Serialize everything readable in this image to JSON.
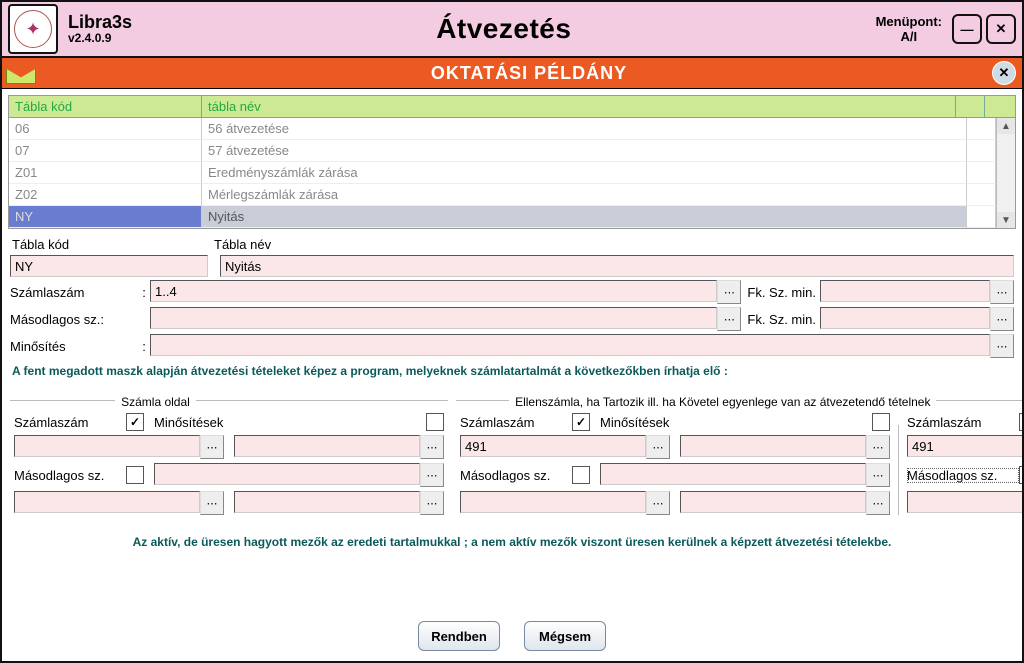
{
  "app": {
    "name": "Libra3s",
    "version": "v2.4.0.9"
  },
  "title": "Átvezetés",
  "menu": {
    "label": "Menüpont:",
    "value": "A/I"
  },
  "banner": {
    "text": "OKTATÁSI PÉLDÁNY"
  },
  "grid": {
    "headers": {
      "code": "Tábla kód",
      "name": "tábla név"
    },
    "rows": [
      {
        "code": "06",
        "name": "56 átvezetése",
        "selected": false
      },
      {
        "code": "07",
        "name": "57 átvezetése",
        "selected": false
      },
      {
        "code": "Z01",
        "name": "Eredményszámlák zárása",
        "selected": false
      },
      {
        "code": "Z02",
        "name": "Mérlegszámlák zárása",
        "selected": false
      },
      {
        "code": "NY",
        "name": "Nyitás",
        "selected": true
      }
    ]
  },
  "form": {
    "code_label": "Tábla kód",
    "code_value": "NY",
    "name_label": "Tábla név",
    "name_value": "Nyitás",
    "acct_label": "Számlaszám",
    "acct_value": "1..4",
    "fkszmin_label": "Fk. Sz. min.",
    "sec_label": "Másodlagos sz.:",
    "sec_value": "",
    "qual_label": "Minősítés",
    "qual_value": ""
  },
  "hint1": "A fent megadott maszk alapján átvezetési tételeket képez a program, melyeknek számlatartalmát a következőkben írhatja elő :",
  "groups": {
    "legend_left": "Számla oldal",
    "legend_right": "Ellenszámla, ha Tartozik  ill. ha Követel egyenlege van az átvezetendő tételnek",
    "acct_label": "Számlaszám",
    "qual_label": "Minősítések",
    "sec_label": "Másodlagos sz.",
    "left": {
      "acct_checked": true,
      "qual_checked": false,
      "acct_value": "",
      "sec_checked": false
    },
    "mid": {
      "acct_checked": true,
      "qual_checked": false,
      "acct_value": "491",
      "sec_checked": false
    },
    "right": {
      "acct_checked": true,
      "qual_checked": false,
      "acct_value": "491",
      "sec_checked": false,
      "sec_focused": true
    }
  },
  "hint2": "Az aktív, de üresen hagyott mezők az eredeti tartalmukkal ; a nem aktív mezők viszont üresen kerülnek a képzett átvezetési tételekbe.",
  "buttons": {
    "ok": "Rendben",
    "cancel": "Mégsem"
  }
}
